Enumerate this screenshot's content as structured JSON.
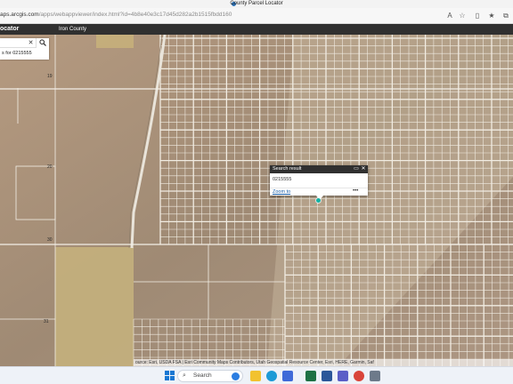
{
  "browser": {
    "window_title": "County Parcel Locator",
    "url_prefix": "aps.arcgis.com",
    "url_path": "/apps/webappviewer/index.html?id=4b8e40e3c17d45d282a2b1515fbdd160",
    "icons": [
      "read-aloud-icon",
      "favorite-star-icon",
      "split-screen-icon",
      "favorites-icon",
      "collections-icon"
    ]
  },
  "app": {
    "title": "ocator",
    "county": "Iron County"
  },
  "search": {
    "value": "",
    "clear_glyph": "✕",
    "suggestion": "s for 0215555"
  },
  "popup": {
    "title": "Search result",
    "content": "0215555",
    "zoom_label": "Zoom to",
    "more_label": "•••"
  },
  "map": {
    "labels": [
      "19",
      "20",
      "30",
      "31"
    ]
  },
  "attribution": "ource: Esri, USDA FSA | Esri Community Maps Contributors, Utah Geospatial Resource Center, Esri, HERE, Garmin, Saf",
  "taskbar": {
    "search_label": "Search",
    "apps": [
      "file-explorer",
      "edge-browser",
      "microsoft-store",
      "excel",
      "word",
      "teams",
      "chrome",
      "settings"
    ]
  }
}
